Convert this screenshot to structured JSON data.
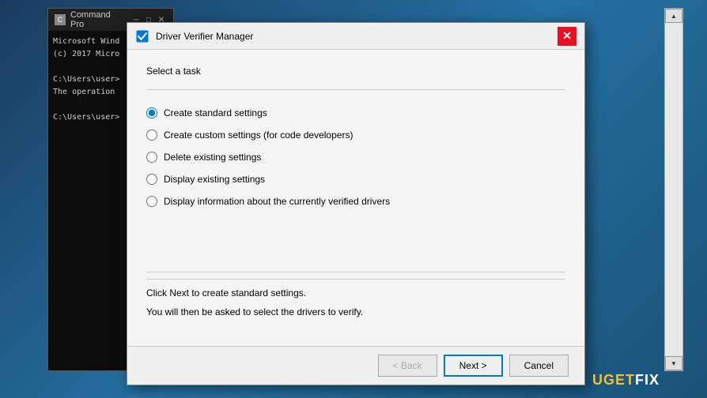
{
  "desktop": {
    "bg": "#1a5276"
  },
  "cmd_window": {
    "title": "Command Pro",
    "icon": "C",
    "lines": [
      "Microsoft Wind",
      "(c) 2017 Micro",
      "",
      "C:\\Users\\user>",
      "The operation",
      "",
      "C:\\Users\\user>"
    ]
  },
  "dialog": {
    "title": "Driver Verifier Manager",
    "icon": "checkmark",
    "close_label": "✕",
    "section_label": "Select a task",
    "options": [
      {
        "id": "opt1",
        "label": "Create standard settings",
        "checked": true
      },
      {
        "id": "opt2",
        "label": "Create custom settings (for code developers)",
        "checked": false
      },
      {
        "id": "opt3",
        "label": "Delete existing settings",
        "checked": false
      },
      {
        "id": "opt4",
        "label": "Display existing settings",
        "checked": false
      },
      {
        "id": "opt5",
        "label": "Display information about the currently verified drivers",
        "checked": false
      }
    ],
    "desc_line1": "Click Next to create standard settings.",
    "desc_line2": "You will then be asked to select the drivers to verify.",
    "footer": {
      "back_label": "< Back",
      "next_label": "Next >",
      "cancel_label": "Cancel"
    }
  },
  "right_panel": {
    "scroll_up": "▲",
    "scroll_down": "▼"
  },
  "watermark": {
    "text": "UG",
    "text2": "ET",
    "text3": "FIX"
  }
}
